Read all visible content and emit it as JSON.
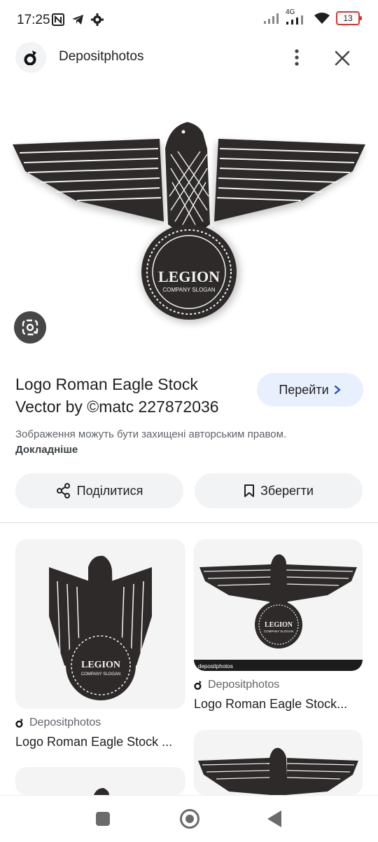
{
  "status_bar": {
    "time": "17:25",
    "network": "4G",
    "battery": "13"
  },
  "source": {
    "name": "Depositphotos"
  },
  "hero": {
    "emblem_text": "LEGION",
    "emblem_slogan": "COMPANY SLOGAN"
  },
  "result": {
    "title": "Logo Roman Eagle Stock Vector by ©matc 227872036",
    "go_label": "Перейти",
    "copyright_text": "Зображення можуть бути захищені авторським правом.",
    "copyright_link": "Докладніше"
  },
  "actions": {
    "share_label": "Поділитися",
    "save_label": "Зберегти"
  },
  "related": [
    {
      "source": "Depositphotos",
      "title": "Logo Roman Eagle Stock ..."
    },
    {
      "source": "Depositphotos",
      "title": "Logo Roman Eagle Stock..."
    }
  ],
  "watermark": "depositphotos",
  "colors": {
    "accent_bg": "#e8f0fe",
    "chip_bg": "#f1f3f4",
    "emblem_dark": "#2e2a2a"
  }
}
